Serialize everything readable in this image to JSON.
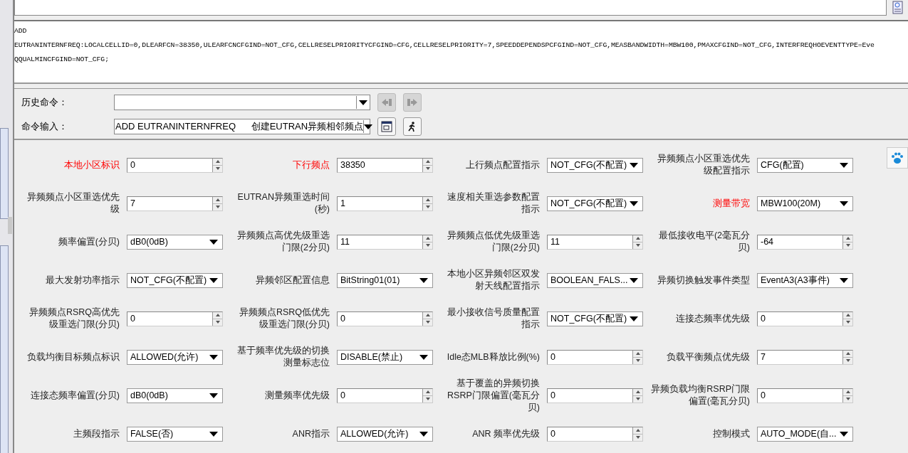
{
  "command_preview": {
    "lines": [
      "ADD",
      "EUTRANINTERNFREQ:LOCALCELLID=0,DLEARFCN=38350,ULEARFCNCFGIND=NOT_CFG,CELLRESELPRIORITYCFGIND=CFG,CELLRESELPRIORITY=7,SPEEDDEPENDSPCFGIND=NOT_CFG,MEASBANDWIDTH=MBW100,PMAXCFGIND=NOT_CFG,INTERFREQHOEVENTTYPE=Eve",
      "QQUALMINCFGIND=NOT_CFG;"
    ]
  },
  "command_panel": {
    "history": {
      "label": "历史命令：",
      "buttons": [
        {
          "kind": "back",
          "disabled": true
        },
        {
          "kind": "forward",
          "disabled": true
        }
      ]
    },
    "input": {
      "label": "命令输入：",
      "value": "ADD EUTRANINTERNFREQ      创建EUTRAN异频相邻频点"
    }
  },
  "parameters": [
    {
      "label": "本地小区标识",
      "value": "0",
      "kind": "spin",
      "required": true
    },
    {
      "label": "下行频点",
      "value": "38350",
      "kind": "spin",
      "required": true
    },
    {
      "label": "上行频点配置指示",
      "value": "NOT_CFG(不配置)",
      "kind": "select",
      "required": false
    },
    {
      "label": "异频频点小区重选优先级配置指示",
      "value": "CFG(配置)",
      "kind": "select",
      "required": false
    },
    {
      "label": "异频频点小区重选优先级",
      "value": "7",
      "kind": "spin",
      "required": false
    },
    {
      "label": "EUTRAN异频重选时间(秒)",
      "value": "1",
      "kind": "spin",
      "required": false
    },
    {
      "label": "速度相关重选参数配置指示",
      "value": "NOT_CFG(不配置)",
      "kind": "select",
      "required": false
    },
    {
      "label": "测量带宽",
      "value": "MBW100(20M)",
      "kind": "select",
      "required": true
    },
    {
      "label": "频率偏置(分贝)",
      "value": "dB0(0dB)",
      "kind": "select",
      "required": false
    },
    {
      "label": "异频频点高优先级重选门限(2分贝)",
      "value": "11",
      "kind": "spin",
      "required": false
    },
    {
      "label": "异频频点低优先级重选门限(2分贝)",
      "value": "11",
      "kind": "spin",
      "required": false
    },
    {
      "label": "最低接收电平(2毫瓦分贝)",
      "value": "-64",
      "kind": "spin",
      "required": false
    },
    {
      "label": "最大发射功率指示",
      "value": "NOT_CFG(不配置)",
      "kind": "select",
      "required": false
    },
    {
      "label": "异频邻区配置信息",
      "value": "BitString01(01)",
      "kind": "select",
      "required": false
    },
    {
      "label": "本地小区异频邻区双发射天线配置指示",
      "value": "BOOLEAN_FALS...",
      "kind": "select",
      "required": false
    },
    {
      "label": "异频切换触发事件类型",
      "value": "EventA3(A3事件)",
      "kind": "select",
      "required": false
    },
    {
      "label": "异频频点RSRQ高优先级重选门限(分贝)",
      "value": "0",
      "kind": "spin",
      "required": false
    },
    {
      "label": "异频频点RSRQ低优先级重选门限(分贝)",
      "value": "0",
      "kind": "spin",
      "required": false
    },
    {
      "label": "最小接收信号质量配置指示",
      "value": "NOT_CFG(不配置)",
      "kind": "select",
      "required": false
    },
    {
      "label": "连接态频率优先级",
      "value": "0",
      "kind": "spin",
      "required": false
    },
    {
      "label": "负载均衡目标频点标识",
      "value": "ALLOWED(允许)",
      "kind": "select",
      "required": false
    },
    {
      "label": "基于频率优先级的切换测量标志位",
      "value": "DISABLE(禁止)",
      "kind": "select",
      "required": false
    },
    {
      "label": "Idle态MLB释放比例(%)",
      "value": "0",
      "kind": "spin",
      "required": false
    },
    {
      "label": "负载平衡频点优先级",
      "value": "7",
      "kind": "spin",
      "required": false
    },
    {
      "label": "连接态频率偏置(分贝)",
      "value": "dB0(0dB)",
      "kind": "select",
      "required": false
    },
    {
      "label": "测量频率优先级",
      "value": "0",
      "kind": "spin",
      "required": false
    },
    {
      "label": "基于覆盖的异频切换RSRP门限偏置(毫瓦分贝)",
      "value": "0",
      "kind": "spin",
      "required": false
    },
    {
      "label": "异频负载均衡RSRP门限偏置(毫瓦分贝)",
      "value": "0",
      "kind": "spin",
      "required": false
    },
    {
      "label": "主频段指示",
      "value": "FALSE(否)",
      "kind": "select",
      "required": false
    },
    {
      "label": "ANR指示",
      "value": "ALLOWED(允许)",
      "kind": "select",
      "required": false
    },
    {
      "label": "ANR 频率优先级",
      "value": "0",
      "kind": "spin",
      "required": false
    },
    {
      "label": "控制模式",
      "value": "AUTO_MODE(自...",
      "kind": "select",
      "required": false
    }
  ]
}
